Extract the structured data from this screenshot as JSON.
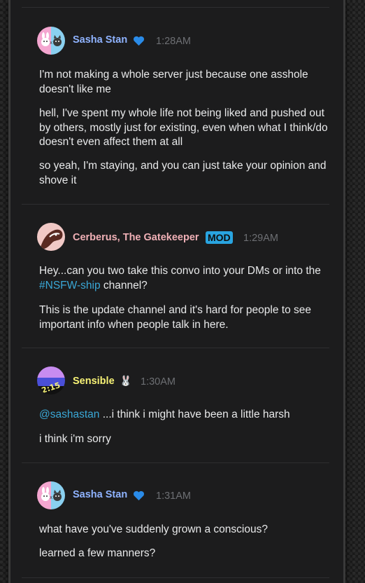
{
  "colors": {
    "sasha_name": "#8fb3ff",
    "cerberus_name": "#f0b0b6",
    "sensible_name": "#f7f276",
    "heart": "#2a8be8",
    "mod_tag": "#29a4e0",
    "link": "#3aa7d6",
    "timestamp": "#6d6f73",
    "message_text": "#e8e9ea"
  },
  "messages": [
    {
      "author": "Sasha Stan",
      "badge_icon": "blue-heart-icon",
      "timestamp": "1:28AM",
      "lines": [
        "I'm not making a whole server just because one asshole doesn't like me",
        "hell, I've spent my whole life not being liked and pushed out by others, mostly just for existing, even when what I think/do doesn't even affect them at all",
        "so yeah, I'm staying, and you can just take your opinion and shove it"
      ]
    },
    {
      "author": "Cerberus, The Gatekeeper",
      "role_tag": "MOD",
      "timestamp": "1:29AM",
      "line1_before": "Hey...can you two take this convo into your DMs or into the ",
      "line1_channel": "#NSFW-ship",
      "line1_after": " channel?",
      "line2": "This is the update channel and it's hard for people to see important info when people talk in here."
    },
    {
      "author": "Sensible",
      "badge_icon": "bunny-icon",
      "badge_text": "🐰",
      "avatar_text": "2:15",
      "timestamp": "1:30AM",
      "mention": "@sashastan",
      "line1_after": " ...i think i might have been a little harsh",
      "line2": "i think i'm sorry"
    },
    {
      "author": "Sasha Stan",
      "badge_icon": "blue-heart-icon",
      "timestamp": "1:31AM",
      "lines": [
        "what have you've suddenly grown a conscious?",
        "learned a few manners?"
      ]
    }
  ]
}
